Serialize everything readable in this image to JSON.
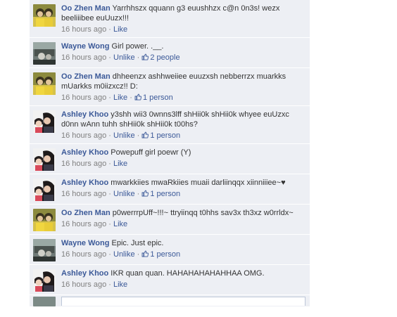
{
  "comments": [
    {
      "author": "Oo Zhen Man",
      "avatar": "yellow",
      "text": "Yarrhhszx qquann g3 euushhzx c@n 0n3s! wezx beeliiibee euUuzx!!!",
      "time": "16 hours ago",
      "action": "Like",
      "likes": ""
    },
    {
      "author": "Wayne Wong",
      "avatar": "grey",
      "text": "Girl power. .__.",
      "time": "16 hours ago",
      "action": "Unlike",
      "likes": "2 people"
    },
    {
      "author": "Oo Zhen Man",
      "avatar": "yellow",
      "text": "dhheenzx ashhweiiee euuzxsh nebberrzx muarkks mUarkks m0iizxcz!! D:",
      "time": "16 hours ago",
      "action": "Like",
      "likes": "1 person"
    },
    {
      "author": "Ashley Khoo",
      "avatar": "girls",
      "text": "y3shh wii3 0wnns3lff shHii0k shHii0k whyee euUzxc d0nn wAnn tuhh shHii0k shHii0k t00hs?",
      "time": "16 hours ago",
      "action": "Unlike",
      "likes": "1 person"
    },
    {
      "author": "Ashley Khoo",
      "avatar": "girls",
      "text": "Powepuff girl poewr (Y)",
      "time": "16 hours ago",
      "action": "Like",
      "likes": ""
    },
    {
      "author": "Ashley Khoo",
      "avatar": "girls",
      "text": "mwarkkiies mwaRkiies muaii darliinqqx xiinniiiee~♥",
      "time": "16 hours ago",
      "action": "Unlike",
      "likes": "1 person"
    },
    {
      "author": "Oo Zhen Man",
      "avatar": "yellow",
      "text": "p0werrrpUff~!!!~ ttryiinqq t0hhs sav3x th3xz w0rrldx~",
      "time": "16 hours ago",
      "action": "Like",
      "likes": ""
    },
    {
      "author": "Wayne Wong",
      "avatar": "grey",
      "text": "Epic. Just epic.",
      "time": "16 hours ago",
      "action": "Unlike",
      "likes": "1 person"
    },
    {
      "author": "Ashley Khoo",
      "avatar": "girls",
      "text": "IKR quan quan. HAHAHAHAHAHHAA OMG.",
      "time": "16 hours ago",
      "action": "Like",
      "likes": ""
    }
  ],
  "separator": " · ",
  "colors": {
    "link": "#3b5998",
    "background": "#edeff4",
    "meta": "#808080"
  }
}
